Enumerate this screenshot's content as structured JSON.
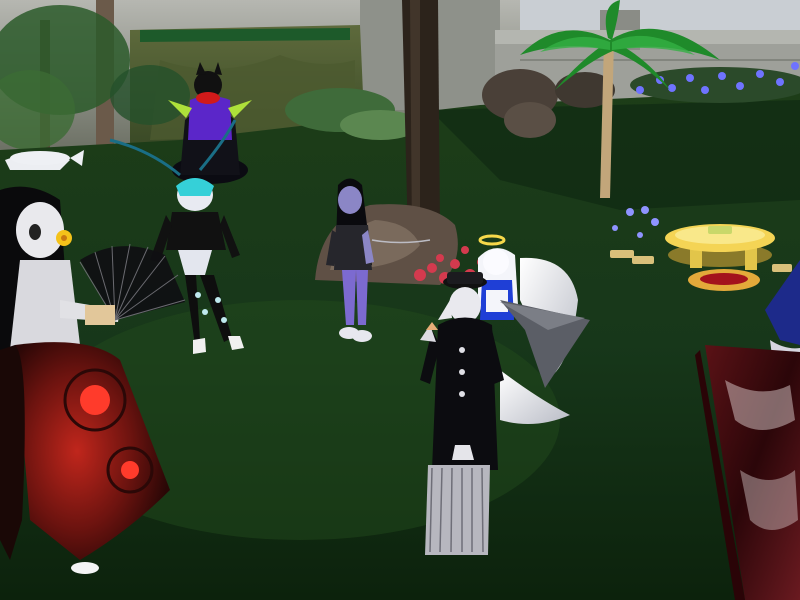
{
  "scene": {
    "setting": "garden-courtyard",
    "objects": [
      "stone-wall",
      "mossy-cliff",
      "rock-pile",
      "tree-trunk",
      "palm-tree",
      "flower-bed",
      "round-stool",
      "red-cushion",
      "dark-red-bench",
      "grass-lawn"
    ],
    "avatars": [
      "black-dragon-avatar",
      "fan-dancer-avatar",
      "blue-hair-avatar",
      "dark-hair-avatar",
      "winged-angel-avatar",
      "black-coat-avatar",
      "blue-figure-avatar"
    ]
  },
  "colors": {
    "sky": "#c9ced3",
    "wall": "#9a9a96",
    "grass_dark": "#0f2a0f",
    "grass_light": "#2e5c22",
    "flower_blue": "#6f73ff",
    "flower_red": "#d43a4e",
    "stool_yellow": "#f4d455",
    "bench_red": "#4a0f12",
    "robe_red": "#9c1b16"
  }
}
